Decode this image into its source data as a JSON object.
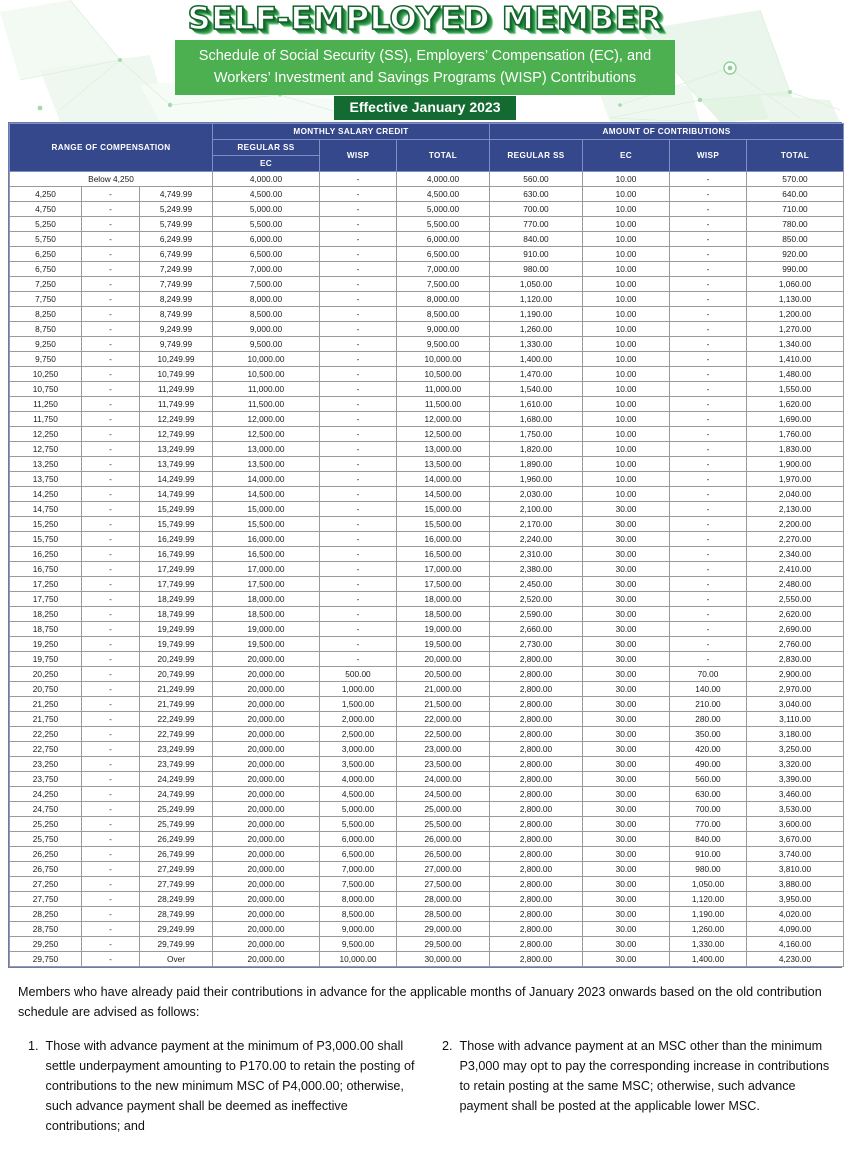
{
  "header": {
    "main_title": "SELF-EMPLOYED MEMBER",
    "subtitle": "Schedule of Social Security (SS), Employers’ Compensation (EC), and Workers’ Investment and Savings Programs (WISP) Contributions",
    "effective_badge": "Effective January 2023",
    "colors": {
      "brand_green": "#4caf50",
      "dark_green": "#146b32",
      "table_header_blue": "#36488c",
      "total_msc_fill": "#bfe1f2",
      "total_contrib_fill": "#cce8f5"
    }
  },
  "table": {
    "headers": {
      "range_of_compensation": "RANGE OF COMPENSATION",
      "monthly_salary_credit": "MONTHLY SALARY CREDIT",
      "amount_of_contributions": "AMOUNT OF CONTRIBUTIONS",
      "msc_regular_ss": "REGULAR SS",
      "msc_ec": "EC",
      "msc_wisp": "WISP",
      "msc_total": "TOTAL",
      "con_regular_ss": "REGULAR SS",
      "con_ec": "EC",
      "con_wisp": "WISP",
      "con_total": "TOTAL"
    },
    "dash": "-",
    "first_row_label": "Below 4,250",
    "last_row_high": "Over",
    "rows": [
      {
        "lo": "",
        "hi": "",
        "label": "Below 4,250",
        "msc_ss": "4,000.00",
        "msc_wisp": "-",
        "msc_total": "4,000.00",
        "con_ss": "560.00",
        "con_ec": "10.00",
        "con_wisp": "-",
        "con_total": "570.00"
      },
      {
        "lo": "4,250",
        "hi": "4,749.99",
        "msc_ss": "4,500.00",
        "msc_wisp": "-",
        "msc_total": "4,500.00",
        "con_ss": "630.00",
        "con_ec": "10.00",
        "con_wisp": "-",
        "con_total": "640.00"
      },
      {
        "lo": "4,750",
        "hi": "5,249.99",
        "msc_ss": "5,000.00",
        "msc_wisp": "-",
        "msc_total": "5,000.00",
        "con_ss": "700.00",
        "con_ec": "10.00",
        "con_wisp": "-",
        "con_total": "710.00"
      },
      {
        "lo": "5,250",
        "hi": "5,749.99",
        "msc_ss": "5,500.00",
        "msc_wisp": "-",
        "msc_total": "5,500.00",
        "con_ss": "770.00",
        "con_ec": "10.00",
        "con_wisp": "-",
        "con_total": "780.00"
      },
      {
        "lo": "5,750",
        "hi": "6,249.99",
        "msc_ss": "6,000.00",
        "msc_wisp": "-",
        "msc_total": "6,000.00",
        "con_ss": "840.00",
        "con_ec": "10.00",
        "con_wisp": "-",
        "con_total": "850.00"
      },
      {
        "lo": "6,250",
        "hi": "6,749.99",
        "msc_ss": "6,500.00",
        "msc_wisp": "-",
        "msc_total": "6,500.00",
        "con_ss": "910.00",
        "con_ec": "10.00",
        "con_wisp": "-",
        "con_total": "920.00"
      },
      {
        "lo": "6,750",
        "hi": "7,249.99",
        "msc_ss": "7,000.00",
        "msc_wisp": "-",
        "msc_total": "7,000.00",
        "con_ss": "980.00",
        "con_ec": "10.00",
        "con_wisp": "-",
        "con_total": "990.00"
      },
      {
        "lo": "7,250",
        "hi": "7,749.99",
        "msc_ss": "7,500.00",
        "msc_wisp": "-",
        "msc_total": "7,500.00",
        "con_ss": "1,050.00",
        "con_ec": "10.00",
        "con_wisp": "-",
        "con_total": "1,060.00"
      },
      {
        "lo": "7,750",
        "hi": "8,249.99",
        "msc_ss": "8,000.00",
        "msc_wisp": "-",
        "msc_total": "8,000.00",
        "con_ss": "1,120.00",
        "con_ec": "10.00",
        "con_wisp": "-",
        "con_total": "1,130.00"
      },
      {
        "lo": "8,250",
        "hi": "8,749.99",
        "msc_ss": "8,500.00",
        "msc_wisp": "-",
        "msc_total": "8,500.00",
        "con_ss": "1,190.00",
        "con_ec": "10.00",
        "con_wisp": "-",
        "con_total": "1,200.00"
      },
      {
        "lo": "8,750",
        "hi": "9,249.99",
        "msc_ss": "9,000.00",
        "msc_wisp": "-",
        "msc_total": "9,000.00",
        "con_ss": "1,260.00",
        "con_ec": "10.00",
        "con_wisp": "-",
        "con_total": "1,270.00"
      },
      {
        "lo": "9,250",
        "hi": "9,749.99",
        "msc_ss": "9,500.00",
        "msc_wisp": "-",
        "msc_total": "9,500.00",
        "con_ss": "1,330.00",
        "con_ec": "10.00",
        "con_wisp": "-",
        "con_total": "1,340.00"
      },
      {
        "lo": "9,750",
        "hi": "10,249.99",
        "msc_ss": "10,000.00",
        "msc_wisp": "-",
        "msc_total": "10,000.00",
        "con_ss": "1,400.00",
        "con_ec": "10.00",
        "con_wisp": "-",
        "con_total": "1,410.00"
      },
      {
        "lo": "10,250",
        "hi": "10,749.99",
        "msc_ss": "10,500.00",
        "msc_wisp": "-",
        "msc_total": "10,500.00",
        "con_ss": "1,470.00",
        "con_ec": "10.00",
        "con_wisp": "-",
        "con_total": "1,480.00"
      },
      {
        "lo": "10,750",
        "hi": "11,249.99",
        "msc_ss": "11,000.00",
        "msc_wisp": "-",
        "msc_total": "11,000.00",
        "con_ss": "1,540.00",
        "con_ec": "10.00",
        "con_wisp": "-",
        "con_total": "1,550.00"
      },
      {
        "lo": "11,250",
        "hi": "11,749.99",
        "msc_ss": "11,500.00",
        "msc_wisp": "-",
        "msc_total": "11,500.00",
        "con_ss": "1,610.00",
        "con_ec": "10.00",
        "con_wisp": "-",
        "con_total": "1,620.00"
      },
      {
        "lo": "11,750",
        "hi": "12,249.99",
        "msc_ss": "12,000.00",
        "msc_wisp": "-",
        "msc_total": "12,000.00",
        "con_ss": "1,680.00",
        "con_ec": "10.00",
        "con_wisp": "-",
        "con_total": "1,690.00"
      },
      {
        "lo": "12,250",
        "hi": "12,749.99",
        "msc_ss": "12,500.00",
        "msc_wisp": "-",
        "msc_total": "12,500.00",
        "con_ss": "1,750.00",
        "con_ec": "10.00",
        "con_wisp": "-",
        "con_total": "1,760.00"
      },
      {
        "lo": "12,750",
        "hi": "13,249.99",
        "msc_ss": "13,000.00",
        "msc_wisp": "-",
        "msc_total": "13,000.00",
        "con_ss": "1,820.00",
        "con_ec": "10.00",
        "con_wisp": "-",
        "con_total": "1,830.00"
      },
      {
        "lo": "13,250",
        "hi": "13,749.99",
        "msc_ss": "13,500.00",
        "msc_wisp": "-",
        "msc_total": "13,500.00",
        "con_ss": "1,890.00",
        "con_ec": "10.00",
        "con_wisp": "-",
        "con_total": "1,900.00"
      },
      {
        "lo": "13,750",
        "hi": "14,249.99",
        "msc_ss": "14,000.00",
        "msc_wisp": "-",
        "msc_total": "14,000.00",
        "con_ss": "1,960.00",
        "con_ec": "10.00",
        "con_wisp": "-",
        "con_total": "1,970.00"
      },
      {
        "lo": "14,250",
        "hi": "14,749.99",
        "msc_ss": "14,500.00",
        "msc_wisp": "-",
        "msc_total": "14,500.00",
        "con_ss": "2,030.00",
        "con_ec": "10.00",
        "con_wisp": "-",
        "con_total": "2,040.00"
      },
      {
        "lo": "14,750",
        "hi": "15,249.99",
        "msc_ss": "15,000.00",
        "msc_wisp": "-",
        "msc_total": "15,000.00",
        "con_ss": "2,100.00",
        "con_ec": "30.00",
        "con_wisp": "-",
        "con_total": "2,130.00"
      },
      {
        "lo": "15,250",
        "hi": "15,749.99",
        "msc_ss": "15,500.00",
        "msc_wisp": "-",
        "msc_total": "15,500.00",
        "con_ss": "2,170.00",
        "con_ec": "30.00",
        "con_wisp": "-",
        "con_total": "2,200.00"
      },
      {
        "lo": "15,750",
        "hi": "16,249.99",
        "msc_ss": "16,000.00",
        "msc_wisp": "-",
        "msc_total": "16,000.00",
        "con_ss": "2,240.00",
        "con_ec": "30.00",
        "con_wisp": "-",
        "con_total": "2,270.00"
      },
      {
        "lo": "16,250",
        "hi": "16,749.99",
        "msc_ss": "16,500.00",
        "msc_wisp": "-",
        "msc_total": "16,500.00",
        "con_ss": "2,310.00",
        "con_ec": "30.00",
        "con_wisp": "-",
        "con_total": "2,340.00"
      },
      {
        "lo": "16,750",
        "hi": "17,249.99",
        "msc_ss": "17,000.00",
        "msc_wisp": "-",
        "msc_total": "17,000.00",
        "con_ss": "2,380.00",
        "con_ec": "30.00",
        "con_wisp": "-",
        "con_total": "2,410.00"
      },
      {
        "lo": "17,250",
        "hi": "17,749.99",
        "msc_ss": "17,500.00",
        "msc_wisp": "-",
        "msc_total": "17,500.00",
        "con_ss": "2,450.00",
        "con_ec": "30.00",
        "con_wisp": "-",
        "con_total": "2,480.00"
      },
      {
        "lo": "17,750",
        "hi": "18,249.99",
        "msc_ss": "18,000.00",
        "msc_wisp": "-",
        "msc_total": "18,000.00",
        "con_ss": "2,520.00",
        "con_ec": "30.00",
        "con_wisp": "-",
        "con_total": "2,550.00"
      },
      {
        "lo": "18,250",
        "hi": "18,749.99",
        "msc_ss": "18,500.00",
        "msc_wisp": "-",
        "msc_total": "18,500.00",
        "con_ss": "2,590.00",
        "con_ec": "30.00",
        "con_wisp": "-",
        "con_total": "2,620.00"
      },
      {
        "lo": "18,750",
        "hi": "19,249.99",
        "msc_ss": "19,000.00",
        "msc_wisp": "-",
        "msc_total": "19,000.00",
        "con_ss": "2,660.00",
        "con_ec": "30.00",
        "con_wisp": "-",
        "con_total": "2,690.00"
      },
      {
        "lo": "19,250",
        "hi": "19,749.99",
        "msc_ss": "19,500.00",
        "msc_wisp": "-",
        "msc_total": "19,500.00",
        "con_ss": "2,730.00",
        "con_ec": "30.00",
        "con_wisp": "-",
        "con_total": "2,760.00"
      },
      {
        "lo": "19,750",
        "hi": "20,249.99",
        "msc_ss": "20,000.00",
        "msc_wisp": "-",
        "msc_total": "20,000.00",
        "con_ss": "2,800.00",
        "con_ec": "30.00",
        "con_wisp": "-",
        "con_total": "2,830.00"
      },
      {
        "lo": "20,250",
        "hi": "20,749.99",
        "msc_ss": "20,000.00",
        "msc_wisp": "500.00",
        "msc_total": "20,500.00",
        "con_ss": "2,800.00",
        "con_ec": "30.00",
        "con_wisp": "70.00",
        "con_total": "2,900.00"
      },
      {
        "lo": "20,750",
        "hi": "21,249.99",
        "msc_ss": "20,000.00",
        "msc_wisp": "1,000.00",
        "msc_total": "21,000.00",
        "con_ss": "2,800.00",
        "con_ec": "30.00",
        "con_wisp": "140.00",
        "con_total": "2,970.00"
      },
      {
        "lo": "21,250",
        "hi": "21,749.99",
        "msc_ss": "20,000.00",
        "msc_wisp": "1,500.00",
        "msc_total": "21,500.00",
        "con_ss": "2,800.00",
        "con_ec": "30.00",
        "con_wisp": "210.00",
        "con_total": "3,040.00"
      },
      {
        "lo": "21,750",
        "hi": "22,249.99",
        "msc_ss": "20,000.00",
        "msc_wisp": "2,000.00",
        "msc_total": "22,000.00",
        "con_ss": "2,800.00",
        "con_ec": "30.00",
        "con_wisp": "280.00",
        "con_total": "3,110.00"
      },
      {
        "lo": "22,250",
        "hi": "22,749.99",
        "msc_ss": "20,000.00",
        "msc_wisp": "2,500.00",
        "msc_total": "22,500.00",
        "con_ss": "2,800.00",
        "con_ec": "30.00",
        "con_wisp": "350.00",
        "con_total": "3,180.00"
      },
      {
        "lo": "22,750",
        "hi": "23,249.99",
        "msc_ss": "20,000.00",
        "msc_wisp": "3,000.00",
        "msc_total": "23,000.00",
        "con_ss": "2,800.00",
        "con_ec": "30.00",
        "con_wisp": "420.00",
        "con_total": "3,250.00"
      },
      {
        "lo": "23,250",
        "hi": "23,749.99",
        "msc_ss": "20,000.00",
        "msc_wisp": "3,500.00",
        "msc_total": "23,500.00",
        "con_ss": "2,800.00",
        "con_ec": "30.00",
        "con_wisp": "490.00",
        "con_total": "3,320.00"
      },
      {
        "lo": "23,750",
        "hi": "24,249.99",
        "msc_ss": "20,000.00",
        "msc_wisp": "4,000.00",
        "msc_total": "24,000.00",
        "con_ss": "2,800.00",
        "con_ec": "30.00",
        "con_wisp": "560.00",
        "con_total": "3,390.00"
      },
      {
        "lo": "24,250",
        "hi": "24,749.99",
        "msc_ss": "20,000.00",
        "msc_wisp": "4,500.00",
        "msc_total": "24,500.00",
        "con_ss": "2,800.00",
        "con_ec": "30.00",
        "con_wisp": "630.00",
        "con_total": "3,460.00"
      },
      {
        "lo": "24,750",
        "hi": "25,249.99",
        "msc_ss": "20,000.00",
        "msc_wisp": "5,000.00",
        "msc_total": "25,000.00",
        "con_ss": "2,800.00",
        "con_ec": "30.00",
        "con_wisp": "700.00",
        "con_total": "3,530.00"
      },
      {
        "lo": "25,250",
        "hi": "25,749.99",
        "msc_ss": "20,000.00",
        "msc_wisp": "5,500.00",
        "msc_total": "25,500.00",
        "con_ss": "2,800.00",
        "con_ec": "30.00",
        "con_wisp": "770.00",
        "con_total": "3,600.00"
      },
      {
        "lo": "25,750",
        "hi": "26,249.99",
        "msc_ss": "20,000.00",
        "msc_wisp": "6,000.00",
        "msc_total": "26,000.00",
        "con_ss": "2,800.00",
        "con_ec": "30.00",
        "con_wisp": "840.00",
        "con_total": "3,670.00"
      },
      {
        "lo": "26,250",
        "hi": "26,749.99",
        "msc_ss": "20,000.00",
        "msc_wisp": "6,500.00",
        "msc_total": "26,500.00",
        "con_ss": "2,800.00",
        "con_ec": "30.00",
        "con_wisp": "910.00",
        "con_total": "3,740.00"
      },
      {
        "lo": "26,750",
        "hi": "27,249.99",
        "msc_ss": "20,000.00",
        "msc_wisp": "7,000.00",
        "msc_total": "27,000.00",
        "con_ss": "2,800.00",
        "con_ec": "30.00",
        "con_wisp": "980.00",
        "con_total": "3,810.00"
      },
      {
        "lo": "27,250",
        "hi": "27,749.99",
        "msc_ss": "20,000.00",
        "msc_wisp": "7,500.00",
        "msc_total": "27,500.00",
        "con_ss": "2,800.00",
        "con_ec": "30.00",
        "con_wisp": "1,050.00",
        "con_total": "3,880.00"
      },
      {
        "lo": "27,750",
        "hi": "28,249.99",
        "msc_ss": "20,000.00",
        "msc_wisp": "8,000.00",
        "msc_total": "28,000.00",
        "con_ss": "2,800.00",
        "con_ec": "30.00",
        "con_wisp": "1,120.00",
        "con_total": "3,950.00"
      },
      {
        "lo": "28,250",
        "hi": "28,749.99",
        "msc_ss": "20,000.00",
        "msc_wisp": "8,500.00",
        "msc_total": "28,500.00",
        "con_ss": "2,800.00",
        "con_ec": "30.00",
        "con_wisp": "1,190.00",
        "con_total": "4,020.00"
      },
      {
        "lo": "28,750",
        "hi": "29,249.99",
        "msc_ss": "20,000.00",
        "msc_wisp": "9,000.00",
        "msc_total": "29,000.00",
        "con_ss": "2,800.00",
        "con_ec": "30.00",
        "con_wisp": "1,260.00",
        "con_total": "4,090.00"
      },
      {
        "lo": "29,250",
        "hi": "29,749.99",
        "msc_ss": "20,000.00",
        "msc_wisp": "9,500.00",
        "msc_total": "29,500.00",
        "con_ss": "2,800.00",
        "con_ec": "30.00",
        "con_wisp": "1,330.00",
        "con_total": "4,160.00"
      },
      {
        "lo": "29,750",
        "hi": "Over",
        "msc_ss": "20,000.00",
        "msc_wisp": "10,000.00",
        "msc_total": "30,000.00",
        "con_ss": "2,800.00",
        "con_ec": "30.00",
        "con_wisp": "1,400.00",
        "con_total": "4,230.00"
      }
    ]
  },
  "footer": {
    "lead": "Members who have already paid their contributions in advance for the applicable months of January 2023 onwards based on the old contribution schedule are advised as follows:",
    "notes": [
      {
        "num": "1.",
        "text": "Those with advance payment at the minimum of P3,000.00 shall settle underpayment amounting to P170.00 to retain the posting of contributions to the new minimum MSC of P4,000.00; otherwise, such advance payment shall be deemed as ineffective contributions; and"
      },
      {
        "num": "2.",
        "text": "Those with advance payment at an MSC other than the minimum P3,000 may opt to pay the corresponding increase in contributions to retain posting at the same MSC; otherwise, such advance payment shall be posted at the applicable lower MSC."
      }
    ]
  }
}
